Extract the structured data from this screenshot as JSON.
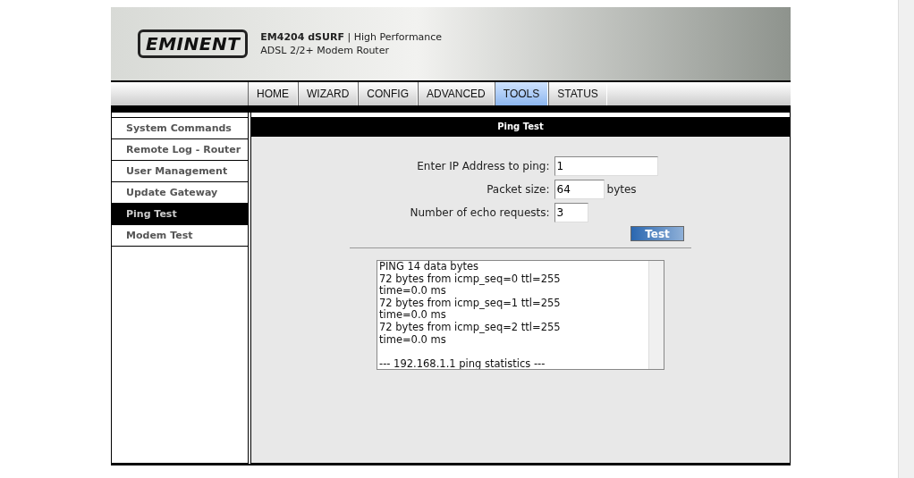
{
  "header": {
    "logo": "EMINENT",
    "model": "EM4204 dSURF",
    "separator": "|",
    "tagline": "High Performance",
    "subtitle": "ADSL 2/2+ Modem Router"
  },
  "tabs": [
    {
      "label": "HOME",
      "selected": false
    },
    {
      "label": "WIZARD",
      "selected": false
    },
    {
      "label": "CONFIG",
      "selected": false
    },
    {
      "label": "ADVANCED",
      "selected": false
    },
    {
      "label": "TOOLS",
      "selected": true
    },
    {
      "label": "STATUS",
      "selected": false
    }
  ],
  "sidebar": {
    "items": [
      {
        "label": "System Commands",
        "selected": false
      },
      {
        "label": "Remote Log - Router",
        "selected": false
      },
      {
        "label": "User Management",
        "selected": false
      },
      {
        "label": "Update Gateway",
        "selected": false
      },
      {
        "label": "Ping Test",
        "selected": true
      },
      {
        "label": "Modem Test",
        "selected": false
      }
    ]
  },
  "panel": {
    "title": "Ping Test",
    "fields": [
      {
        "label": "Enter IP Address to ping:",
        "value": "1",
        "kind": "wide"
      },
      {
        "label": "Packet size:",
        "value": "64",
        "unit": "bytes",
        "kind": "medium"
      },
      {
        "label": "Number of echo requests:",
        "value": "3",
        "kind": "small"
      }
    ],
    "button": "Test",
    "output": [
      "PING 14 data bytes",
      "72 bytes from icmp_seq=0 ttl=255",
      "time=0.0 ms",
      "72 bytes from icmp_seq=1 ttl=255",
      "time=0.0 ms",
      "72 bytes from icmp_seq=2 ttl=255",
      "time=0.0 ms"
    ],
    "output_footer": "--- 192.168.1.1 ping statistics ---"
  }
}
